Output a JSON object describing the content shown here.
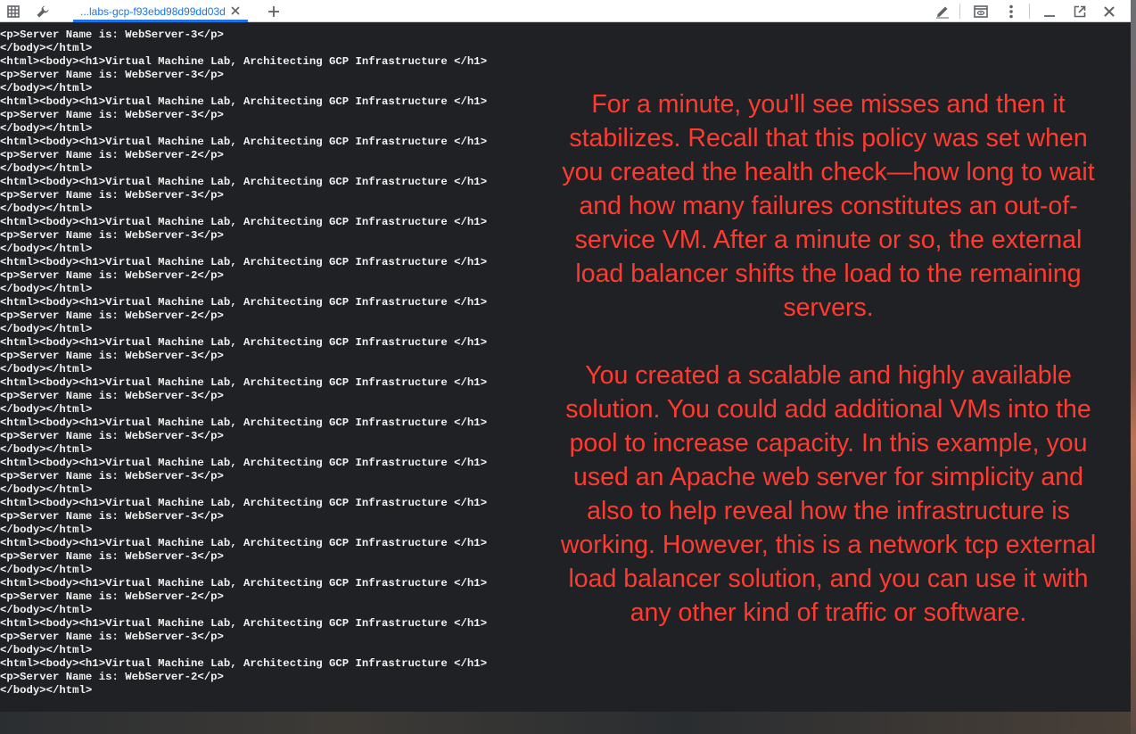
{
  "tabbar": {
    "tab_title": "...labs-gcp-f93ebd98d99dd03d",
    "icons": [
      "grid-icon",
      "wrench-icon",
      "close-icon",
      "plus-icon",
      "pencil-icon",
      "preview-icon",
      "more-vert-icon",
      "minimize-icon",
      "popout-icon",
      "close-window-icon"
    ]
  },
  "terminal": {
    "lines": [
      "<p>Server Name is: WebServer-3</p>",
      "</body></html>",
      "<html><body><h1>Virtual Machine Lab, Architecting GCP Infrastructure </h1>",
      "<p>Server Name is: WebServer-3</p>",
      "</body></html>",
      "<html><body><h1>Virtual Machine Lab, Architecting GCP Infrastructure </h1>",
      "<p>Server Name is: WebServer-3</p>",
      "</body></html>",
      "<html><body><h1>Virtual Machine Lab, Architecting GCP Infrastructure </h1>",
      "<p>Server Name is: WebServer-2</p>",
      "</body></html>",
      "<html><body><h1>Virtual Machine Lab, Architecting GCP Infrastructure </h1>",
      "<p>Server Name is: WebServer-3</p>",
      "</body></html>",
      "<html><body><h1>Virtual Machine Lab, Architecting GCP Infrastructure </h1>",
      "<p>Server Name is: WebServer-3</p>",
      "</body></html>",
      "<html><body><h1>Virtual Machine Lab, Architecting GCP Infrastructure </h1>",
      "<p>Server Name is: WebServer-2</p>",
      "</body></html>",
      "<html><body><h1>Virtual Machine Lab, Architecting GCP Infrastructure </h1>",
      "<p>Server Name is: WebServer-2</p>",
      "</body></html>",
      "<html><body><h1>Virtual Machine Lab, Architecting GCP Infrastructure </h1>",
      "<p>Server Name is: WebServer-3</p>",
      "</body></html>",
      "<html><body><h1>Virtual Machine Lab, Architecting GCP Infrastructure </h1>",
      "<p>Server Name is: WebServer-3</p>",
      "</body></html>",
      "<html><body><h1>Virtual Machine Lab, Architecting GCP Infrastructure </h1>",
      "<p>Server Name is: WebServer-3</p>",
      "</body></html>",
      "<html><body><h1>Virtual Machine Lab, Architecting GCP Infrastructure </h1>",
      "<p>Server Name is: WebServer-3</p>",
      "</body></html>",
      "<html><body><h1>Virtual Machine Lab, Architecting GCP Infrastructure </h1>",
      "<p>Server Name is: WebServer-3</p>",
      "</body></html>",
      "<html><body><h1>Virtual Machine Lab, Architecting GCP Infrastructure </h1>",
      "<p>Server Name is: WebServer-3</p>",
      "</body></html>",
      "<html><body><h1>Virtual Machine Lab, Architecting GCP Infrastructure </h1>",
      "<p>Server Name is: WebServer-2</p>",
      "</body></html>",
      "<html><body><h1>Virtual Machine Lab, Architecting GCP Infrastructure </h1>",
      "<p>Server Name is: WebServer-3</p>",
      "</body></html>",
      "<html><body><h1>Virtual Machine Lab, Architecting GCP Infrastructure </h1>",
      "<p>Server Name is: WebServer-2</p>",
      "</body></html>"
    ]
  },
  "annotation": {
    "paragraph_1": "For a minute, you'll see misses and then it stabilizes. Recall that this policy was set when you created the health check—how long to wait and how many failures constitutes an out-of-service VM. After a minute or so, the external load balancer shifts the load to the remaining servers.",
    "paragraph_2": "You created a scalable and highly available solution. You could add additional VMs into the pool to increase capacity. In this example, you used an Apache web server for simplicity and also to help reveal how the infrastructure is working. However, this is a network tcp external load balancer solution, and you can use it with any other kind of traffic or software.",
    "color": "#ff3b30"
  }
}
